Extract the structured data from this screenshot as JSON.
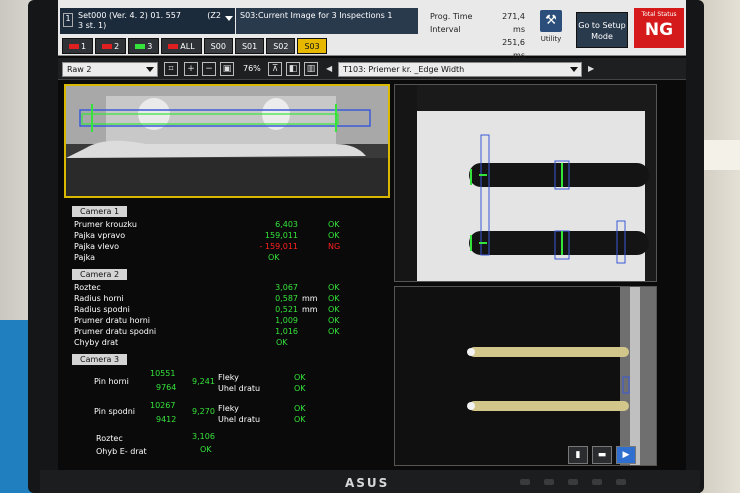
{
  "header": {
    "program_number": "1",
    "program_line1": "Set000 (Ver. 4. 2) 01. 557",
    "program_line2": "3 st. 1)",
    "zone": "(Z2",
    "status_message": "S03:Current Image for 3 Inspections 1",
    "prog_time_label": "Prog. Time",
    "prog_time_value": "271,4 ms",
    "interval_label": "Interval",
    "interval_value": "251,6 ms",
    "utility_label": "Utility",
    "goto_label": "Go to Setup Mode",
    "total_status_label": "Total Status",
    "total_status_value": "NG"
  },
  "tabs": [
    {
      "label": "1",
      "color": "#e02020"
    },
    {
      "label": "2",
      "color": "#e02020"
    },
    {
      "label": "3",
      "color": "#35e43a"
    },
    {
      "label": "ALL",
      "color": "#e02020"
    },
    {
      "label": "S00"
    },
    {
      "label": "S01"
    },
    {
      "label": "S02"
    },
    {
      "label": "S03",
      "active": true
    }
  ],
  "toolbar": {
    "view_select": "Raw 2",
    "zoom": "76%",
    "tool_select": "T103: Priemer kr. _Edge Width"
  },
  "camera1": {
    "label": "Camera  1",
    "rows": [
      {
        "name": "Prumer krouzku",
        "value": "6,403",
        "unit": "",
        "status": "OK"
      },
      {
        "name": "Pajka vpravo",
        "value": "159,011",
        "unit": "",
        "status": "OK"
      },
      {
        "name": "Pajka vlevo",
        "value": "- 159,011",
        "unit": "",
        "status": "NG"
      },
      {
        "name": "  Pajka",
        "value": "",
        "unit": "",
        "status": "",
        "mid_status": "OK"
      }
    ]
  },
  "camera2": {
    "label": "Camera  2",
    "rows": [
      {
        "name": "Roztec",
        "value": "3,067",
        "unit": "",
        "status": "OK"
      },
      {
        "name": "Radius horni",
        "value": "0,587",
        "unit": "mm",
        "status": "OK"
      },
      {
        "name": "Radius spodni",
        "value": "0,521",
        "unit": "mm",
        "status": "OK"
      },
      {
        "name": "Prumer dratu horni",
        "value": "1,009",
        "unit": "",
        "status": "OK"
      },
      {
        "name": "Prumer dratu spodni",
        "value": "1,016",
        "unit": "",
        "status": "OK"
      },
      {
        "name": "  Chyby  drat",
        "value": "",
        "unit": "",
        "status": "",
        "mid_status": "OK"
      }
    ]
  },
  "camera3": {
    "label": "Camera  3",
    "pin_horni_label": "Pin  horni",
    "pin_horni_v1": "10551",
    "pin_horni_v2": "9764",
    "pin_horni_v3": "9,241",
    "pin_spodni_label": "Pin  spodni",
    "pin_spodni_v1": "10267",
    "pin_spodni_v2": "9412",
    "pin_spodni_v3": "9,270",
    "fleky_label": "Fleky",
    "uhel_label": "Uhel  dratu",
    "fleky_status_1": "OK",
    "uhel_status_1": "OK",
    "fleky_status_2": "OK",
    "uhel_status_2": "OK",
    "roztec_label": "Roztec",
    "roztec_value": "3,106",
    "ohyb_label": "Ohyb  E- drat",
    "ohyb_status": "OK"
  },
  "monitor_brand": "ASUS",
  "colors": {
    "ok": "#35e43a",
    "ng": "#ff2020",
    "active_tab": "#e6b800"
  }
}
